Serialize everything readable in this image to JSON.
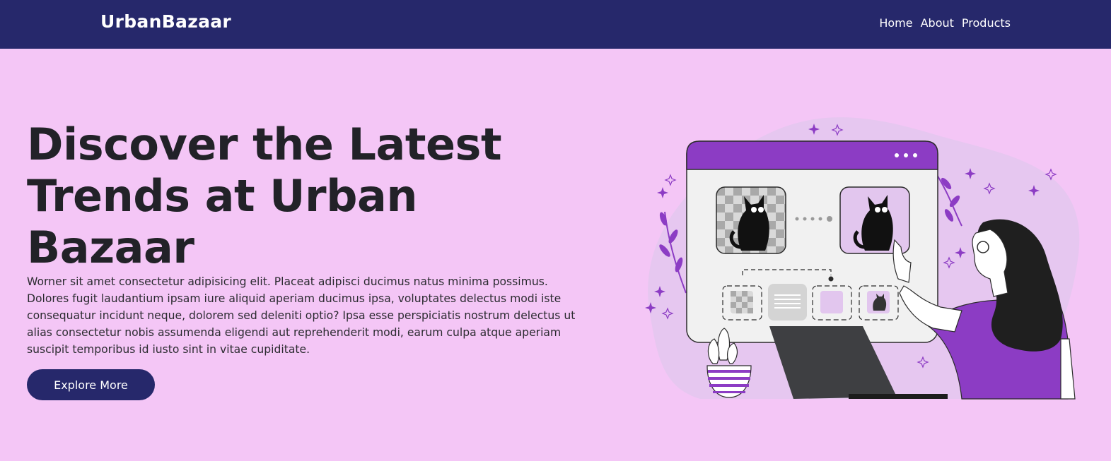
{
  "navbar": {
    "brand": "UrbanBazaar",
    "links": [
      "Home",
      "About",
      "Products"
    ]
  },
  "hero": {
    "title": "Discover the Latest Trends at Urban Bazaar",
    "description": "Worner sit amet consectetur adipisicing elit. Placeat adipisci ducimus natus minima possimus. Dolores fugit laudantium ipsam iure aliquid aperiam ducimus ipsa, voluptates delectus modi iste consequatur incidunt neque, dolorem sed deleniti optio? Ipsa esse perspiciatis nostrum delectus ut alias consectetur nobis assumenda eligendi aut reprehenderit modi, earum culpa atque aperiam suscipit temporibus id iusto sint in vitae cupiditate.",
    "cta_label": "Explore More"
  },
  "colors": {
    "nav_bg": "#26286b",
    "page_bg": "#f4c6f6",
    "accent_purple": "#8c3cc4",
    "button_bg": "#26286b"
  },
  "illustration": {
    "subject": "woman-pointing-at-image-editor-window",
    "icons": [
      "cat-image-icon",
      "checker-transparent-icon",
      "document-lines-icon",
      "plant-pot-icon",
      "laptop-icon",
      "sparkle-icon"
    ]
  }
}
